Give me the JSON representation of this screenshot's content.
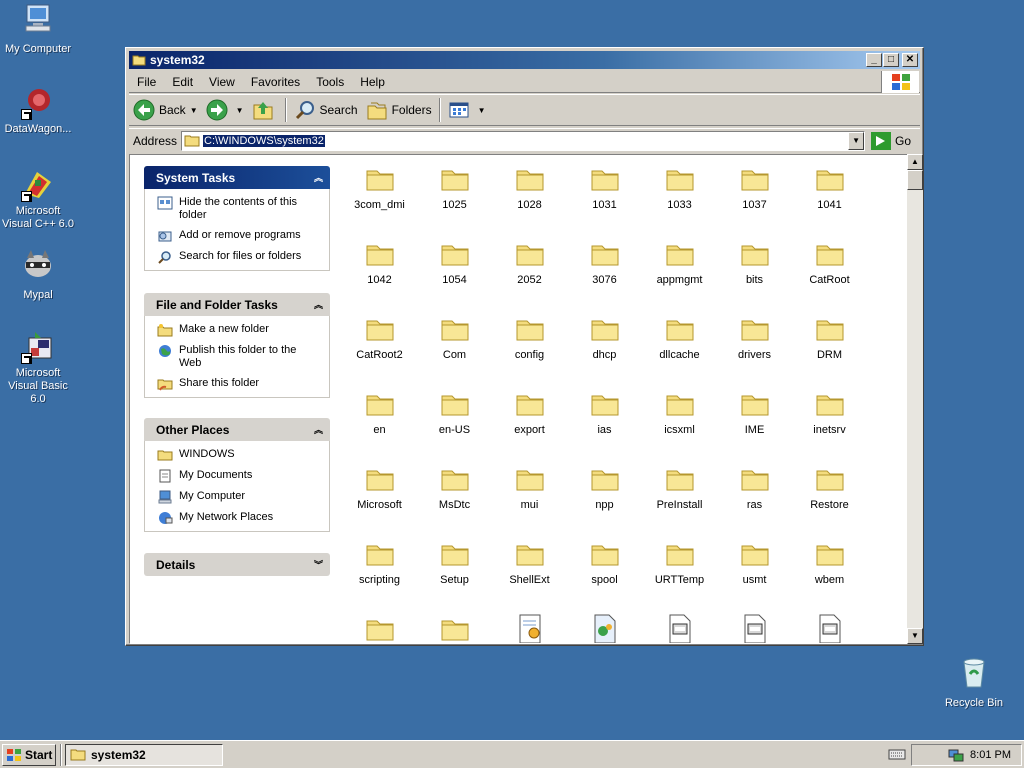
{
  "desktop": {
    "icons": [
      {
        "label": "My Computer"
      },
      {
        "label": "DataWagon..."
      },
      {
        "label": "Microsoft Visual C++ 6.0"
      },
      {
        "label": "Mypal"
      },
      {
        "label": "Microsoft Visual Basic 6.0"
      },
      {
        "label": "Recycle Bin"
      }
    ]
  },
  "window": {
    "title": "system32",
    "menu": [
      "File",
      "Edit",
      "View",
      "Favorites",
      "Tools",
      "Help"
    ],
    "toolbar": {
      "back": "Back",
      "search": "Search",
      "folders": "Folders"
    },
    "address": {
      "label": "Address",
      "value": "C:\\WINDOWS\\system32",
      "go": "Go"
    }
  },
  "panes": {
    "system_tasks": {
      "title": "System Tasks",
      "items": [
        "Hide the contents of this folder",
        "Add or remove programs",
        "Search for files or folders"
      ]
    },
    "file_folder_tasks": {
      "title": "File and Folder Tasks",
      "items": [
        "Make a new folder",
        "Publish this folder to the Web",
        "Share this folder"
      ]
    },
    "other_places": {
      "title": "Other Places",
      "items": [
        "WINDOWS",
        "My Documents",
        "My Computer",
        "My Network Places"
      ]
    },
    "details": {
      "title": "Details"
    }
  },
  "files": [
    "3com_dmi",
    "1025",
    "1028",
    "1031",
    "1033",
    "1037",
    "1041",
    "1042",
    "1054",
    "2052",
    "3076",
    "appmgmt",
    "bits",
    "CatRoot",
    "CatRoot2",
    "Com",
    "config",
    "dhcp",
    "dllcache",
    "drivers",
    "DRM",
    "en",
    "en-US",
    "export",
    "ias",
    "icsxml",
    "IME",
    "inetsrv",
    "Microsoft",
    "MsDtc",
    "mui",
    "npp",
    "PreInstall",
    "ras",
    "Restore",
    "scripting",
    "Setup",
    "ShellExt",
    "spool",
    "URTTemp",
    "usmt",
    "wbem"
  ],
  "taskbar": {
    "start": "Start",
    "task": "system32",
    "clock": "8:01 PM"
  }
}
